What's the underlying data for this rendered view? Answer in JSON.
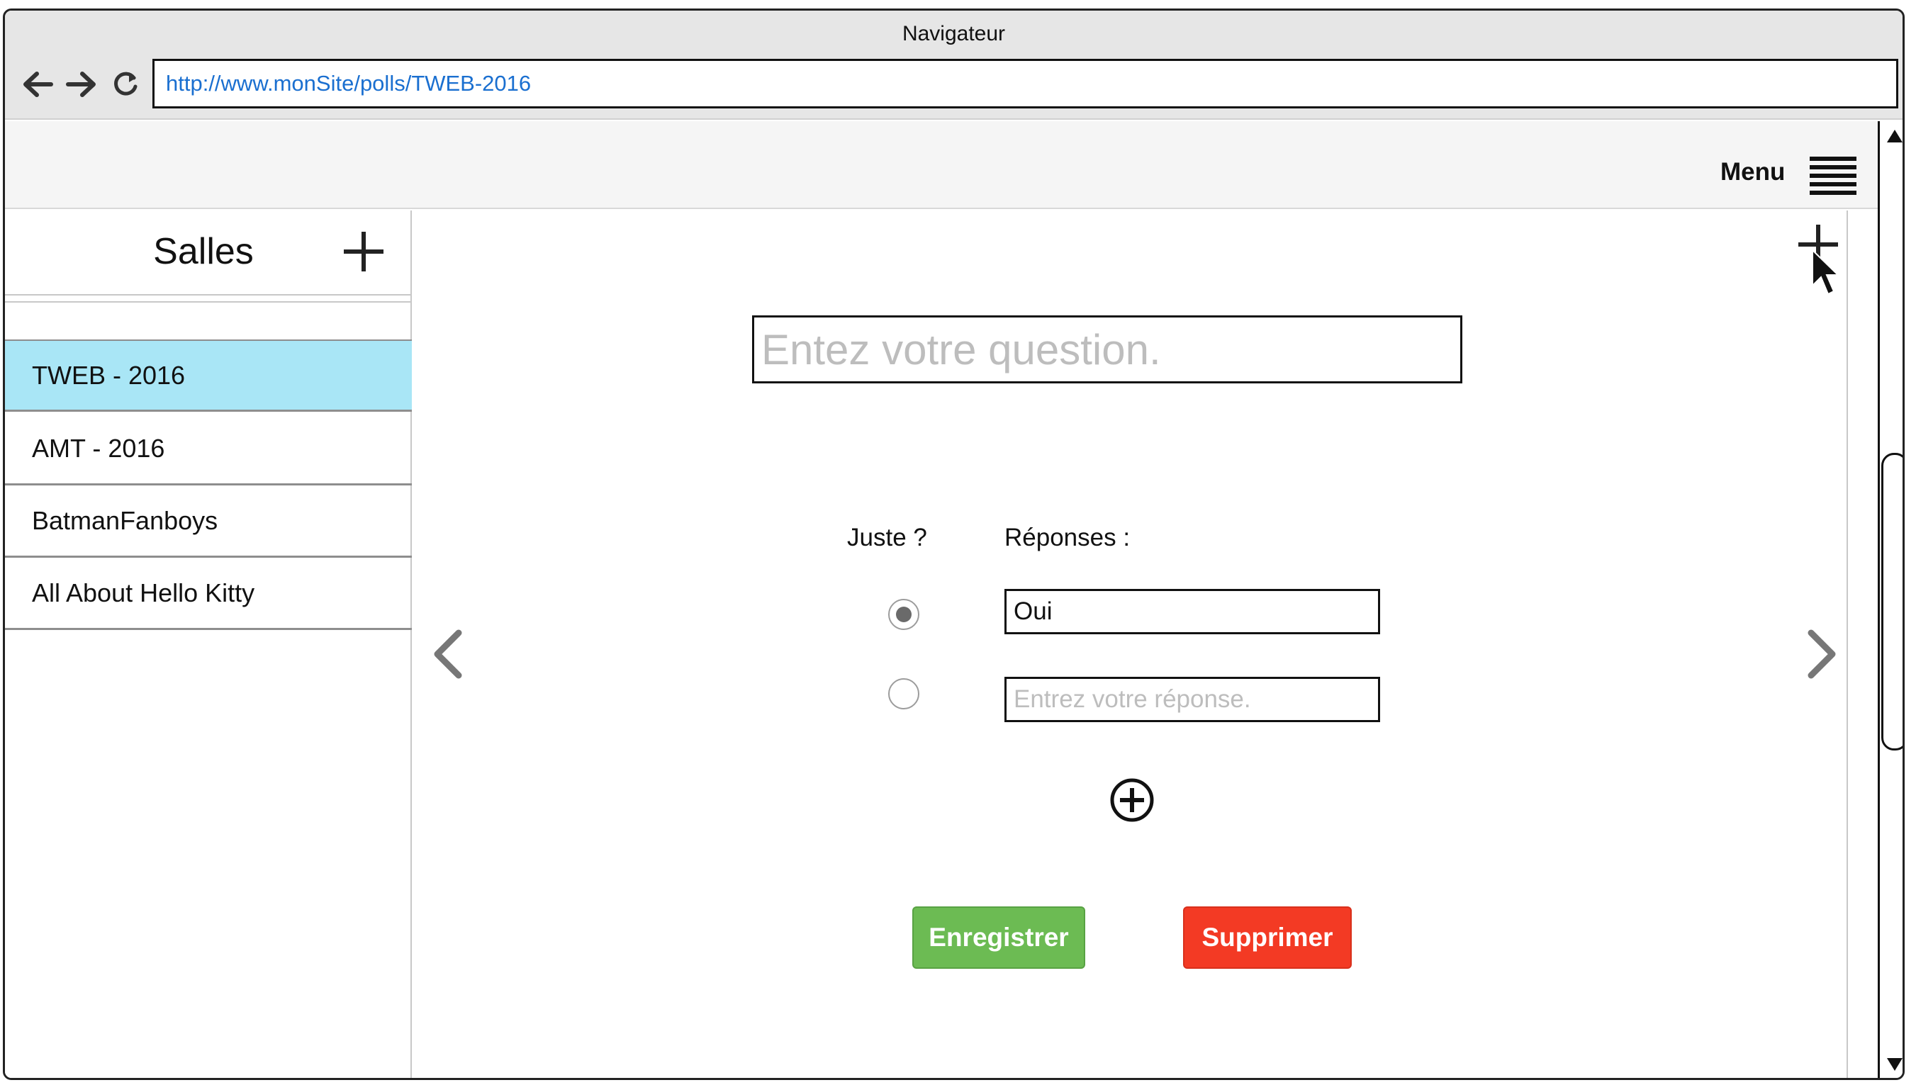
{
  "browser": {
    "title": "Navigateur",
    "url": "http://www.monSite/polls/TWEB-2016"
  },
  "header": {
    "menu_label": "Menu"
  },
  "sidebar": {
    "title": "Salles",
    "rooms": [
      {
        "label": "TWEB - 2016",
        "selected": true
      },
      {
        "label": "AMT - 2016",
        "selected": false
      },
      {
        "label": "BatmanFanboys",
        "selected": false
      },
      {
        "label": "All About Hello Kitty",
        "selected": false
      }
    ]
  },
  "editor": {
    "question_placeholder": "Entez votre question.",
    "juste_label": "Juste ?",
    "responses_label": "Réponses :",
    "answers": [
      {
        "value": "Oui",
        "placeholder": "",
        "correct": true
      },
      {
        "value": "",
        "placeholder": "Entrez votre réponse.",
        "correct": false
      }
    ],
    "save_label": "Enregistrer",
    "delete_label": "Supprimer"
  },
  "colors": {
    "selected_room": "#a9e6f6",
    "save_button": "#6cbb53",
    "delete_button": "#f33a24",
    "url_text": "#1a6fd0"
  }
}
